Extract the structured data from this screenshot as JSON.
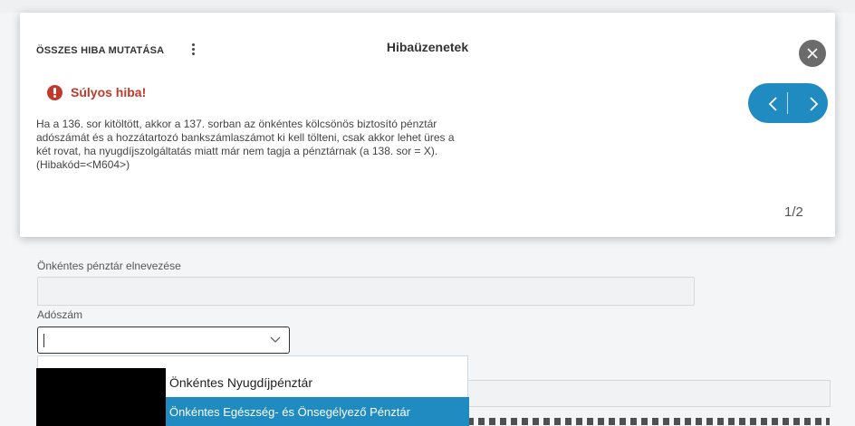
{
  "error_panel": {
    "show_all_label": "ÖSSZES HIBA MUTATÁSA",
    "title": "Hibaüzenetek",
    "severity_label": "Súlyos hiba!",
    "message_lines": [
      "Ha a 136. sor kitöltött, akkor a 137. sorban az önkéntes kölcsönös biztosító pénztár",
      "adószámát és a hozzátartozó bankszámlaszámot ki kell tölteni, csak akkor lehet üres a",
      "két rovat, ha nyugdíjszolgáltatás miatt már nem tagja a pénztárnak (a 138. sor = X).",
      "(Hibakód=<M604>)"
    ],
    "counter": "1/2",
    "icons": {
      "close": "close-icon",
      "prev": "chevron-left-icon",
      "next": "chevron-right-icon",
      "error": "exclamation-circle-icon",
      "menu": "kebab-menu-icon"
    }
  },
  "form": {
    "fund_name_label": "Önkéntes pénztár elnevezése",
    "fund_name_value": "",
    "tax_number_label": "Adószám",
    "tax_number_value": ""
  },
  "dropdown": {
    "options": [
      {
        "label": "Önkéntes Nyugdíjpénztár",
        "selected": false
      },
      {
        "label": "Önkéntes Egészség- és Önsegélyező Pénztár",
        "selected": true
      }
    ]
  },
  "colors": {
    "accent": "#1f8bc0",
    "error": "#c0392b",
    "close_button": "#6b6b6b"
  }
}
